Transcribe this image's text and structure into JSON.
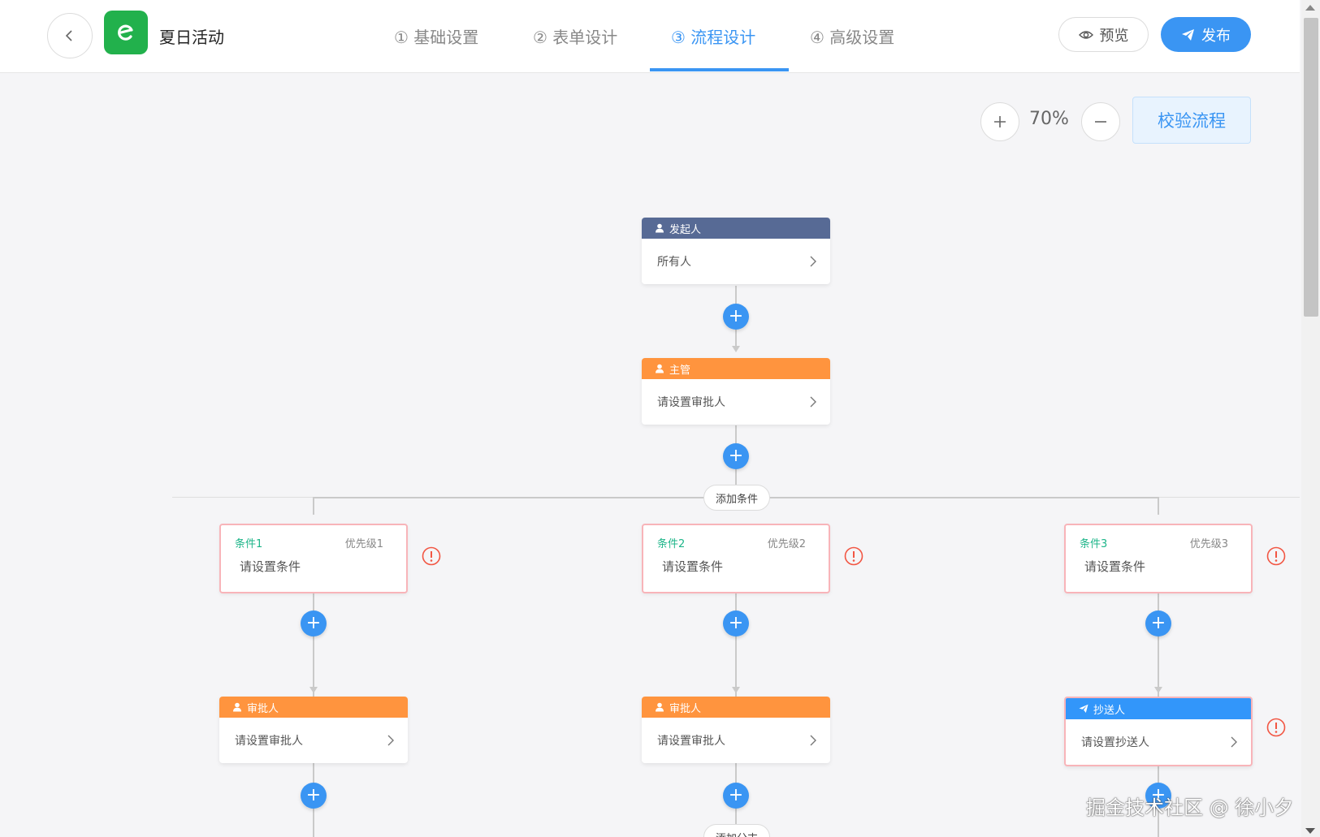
{
  "header": {
    "app_title": "夏日活动",
    "steps": [
      {
        "label": "① 基础设置"
      },
      {
        "label": "② 表单设计"
      },
      {
        "label": "③ 流程设计"
      },
      {
        "label": "④ 高级设置"
      }
    ],
    "active_step": 2,
    "preview_label": "预览",
    "publish_label": "发布"
  },
  "toolbar": {
    "zoom_level": "70%",
    "validate_label": "校验流程"
  },
  "flow": {
    "initiator": {
      "title": "发起人",
      "value": "所有人"
    },
    "supervisor": {
      "title": "主管",
      "value": "请设置审批人"
    },
    "add_condition_label": "添加条件",
    "conditions": [
      {
        "name": "条件1",
        "priority": "优先级1",
        "desc": "请设置条件"
      },
      {
        "name": "条件2",
        "priority": "优先级2",
        "desc": "请设置条件"
      },
      {
        "name": "条件3",
        "priority": "优先级3",
        "desc": "请设置条件"
      }
    ],
    "branch_nodes": [
      {
        "title": "审批人",
        "value": "请设置审批人"
      },
      {
        "title": "审批人",
        "value": "请设置审批人"
      },
      {
        "title": "抄送人",
        "value": "请设置抄送人"
      }
    ],
    "add_branch_label": "添加分支"
  },
  "colors": {
    "accent": "#3a95f3",
    "initiator_head": "#576a95",
    "approver_head": "#ff943e",
    "cc_head": "#3296fa",
    "condition_text": "#1db589",
    "error": "#f25643"
  },
  "watermark": "掘金技术社区 @ 徐小夕"
}
